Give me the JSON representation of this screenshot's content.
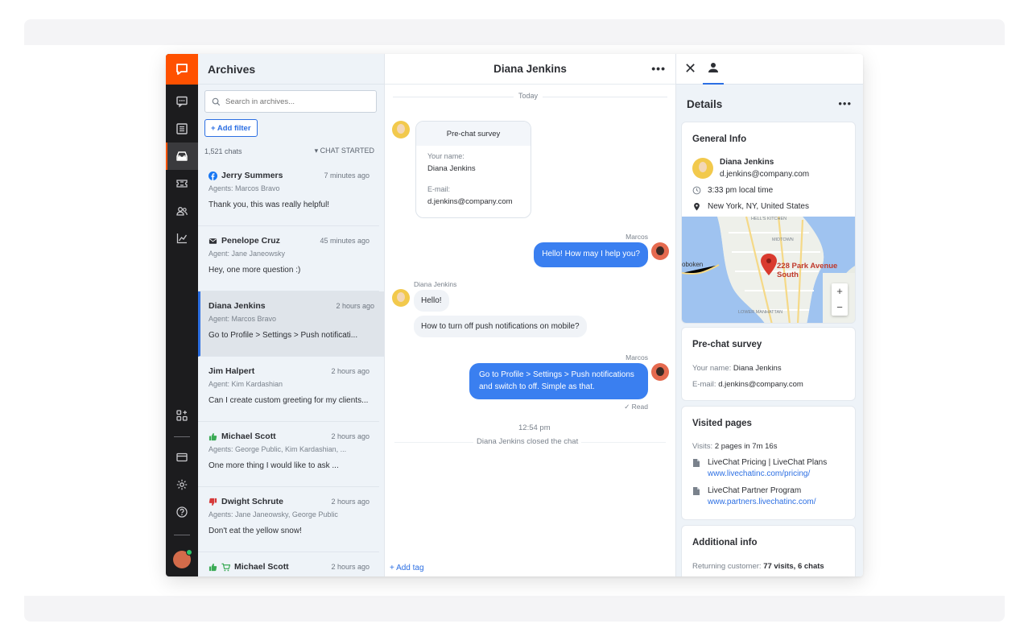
{
  "nav": {
    "icons": [
      "chat-bubble-icon",
      "chats-icon",
      "list-icon",
      "archives-icon",
      "tickets-icon",
      "customers-icon",
      "reports-icon",
      "apps-icon",
      "billing-icon",
      "settings-icon",
      "help-icon"
    ],
    "active": "archives",
    "accent": "#ff5100"
  },
  "archives": {
    "title": "Archives",
    "search_placeholder": "Search in archives...",
    "add_filter": "+ Add filter",
    "count": "1,521 chats",
    "sort": "CHAT STARTED",
    "chats": [
      {
        "name": "Jerry Summers",
        "time": "7 minutes ago",
        "agents": "Agents: Marcos Bravo",
        "preview": "Thank you, this was really helpful!",
        "icon": "facebook-icon"
      },
      {
        "name": "Penelope Cruz",
        "time": "45 minutes ago",
        "agents": "Agent: Jane Janeowsky",
        "preview": "Hey, one more question :)",
        "icon": "mail-icon"
      },
      {
        "name": "Diana Jenkins",
        "time": "2 hours ago",
        "agents": "Agent: Marcos Bravo",
        "preview": "Go to Profile > Settings > Push notificati...",
        "icon": ""
      },
      {
        "name": "Jim Halpert",
        "time": "2 hours ago",
        "agents": "Agent: Kim Kardashian",
        "preview": "Can I create custom greeting for my clients...",
        "icon": ""
      },
      {
        "name": "Michael Scott",
        "time": "2 hours ago",
        "agents": "Agents: George Public, Kim Kardashian, ...",
        "preview": "One more thing I would like to ask ...",
        "icon": "thumbs-up-icon"
      },
      {
        "name": "Dwight Schrute",
        "time": "2 hours ago",
        "agents": "Agents: Jane Janeowsky, George Public",
        "preview": "Don't eat the yellow snow!",
        "icon": "thumbs-down-icon"
      },
      {
        "name": "Michael Scott",
        "time": "2 hours ago",
        "agents": "",
        "preview": "",
        "icon": "thumbs-up-cart-icon"
      }
    ]
  },
  "conversation": {
    "title": "Diana Jenkins",
    "day": "Today",
    "survey": {
      "title": "Pre-chat survey",
      "name_label": "Your name:",
      "name_value": "Diana Jenkins",
      "email_label": "E-mail:",
      "email_value": "d.jenkins@company.com"
    },
    "messages": [
      {
        "sender": "Marcos",
        "text": "Hello! How may I help you?"
      },
      {
        "sender": "Diana Jenkins",
        "text": "Hello!"
      },
      {
        "sender": "",
        "text": "How to turn off push notifications on mobile?"
      },
      {
        "sender": "Marcos",
        "text": "Go to Profile > Settings > Push notifications and switch to off. Simple as that."
      }
    ],
    "read": "✓ Read",
    "closed_time": "12:54 pm",
    "closed_text": "Diana Jenkins closed the chat",
    "add_tag": "+ Add tag"
  },
  "details": {
    "title": "Details",
    "general": {
      "title": "General Info",
      "name": "Diana Jenkins",
      "email": "d.jenkins@company.com",
      "local_time": "3:33 pm local time",
      "location": "New York, NY, United States",
      "map_address": "228 Park Avenue South",
      "map_labels": [
        "oboken",
        "LOWER MANHATTAN",
        "HELL'S KITCHEN",
        "MIDTOWN"
      ]
    },
    "survey": {
      "title": "Pre-chat survey",
      "name_label": "Your name:",
      "name_value": "Diana Jenkins",
      "email_label": "E-mail:",
      "email_value": "d.jenkins@company.com"
    },
    "visited": {
      "title": "Visited pages",
      "visits_label": "Visits:",
      "visits_value": "2 pages in 7m 16s",
      "pages": [
        {
          "title": "LiveChat Pricing | LiveChat Plans",
          "url": "www.livechatinc.com/pricing/"
        },
        {
          "title": "LiveChat Partner Program",
          "url": "www.partners.livechatinc.com/"
        }
      ]
    },
    "additional": {
      "title": "Additional info",
      "label": "Returning customer:",
      "value": "77 visits, 6 chats"
    }
  }
}
